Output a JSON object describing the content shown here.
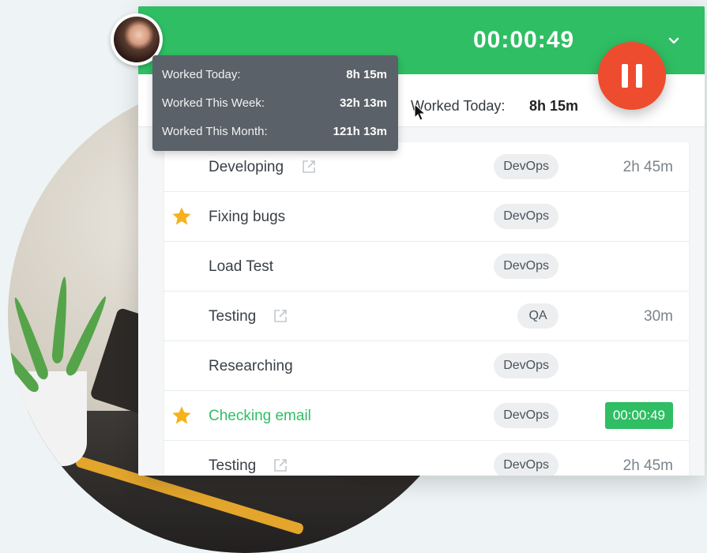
{
  "header": {
    "timer": "00:00:49"
  },
  "subbar": {
    "worked_today_label": "Worked Today:",
    "worked_today_value": "8h 15m"
  },
  "tooltip": {
    "rows": [
      {
        "label": "Worked Today:",
        "value": "8h 15m"
      },
      {
        "label": "Worked This Week:",
        "value": "32h 13m"
      },
      {
        "label": "Worked This Month:",
        "value": "121h 13m"
      }
    ]
  },
  "tasks": [
    {
      "name": "Developing",
      "tag": "DevOps",
      "duration": "2h 45m",
      "starred": false,
      "external": true,
      "active": false
    },
    {
      "name": "Fixing bugs",
      "tag": "DevOps",
      "duration": "",
      "starred": true,
      "external": false,
      "active": false
    },
    {
      "name": "Load Test",
      "tag": "DevOps",
      "duration": "",
      "starred": false,
      "external": false,
      "active": false
    },
    {
      "name": "Testing",
      "tag": "QA",
      "duration": "30m",
      "starred": false,
      "external": true,
      "active": false
    },
    {
      "name": "Researching",
      "tag": "DevOps",
      "duration": "",
      "starred": false,
      "external": false,
      "active": false
    },
    {
      "name": "Checking email",
      "tag": "DevOps",
      "duration": "00:00:49",
      "starred": true,
      "external": false,
      "active": true
    },
    {
      "name": "Testing",
      "tag": "DevOps",
      "duration": "2h 45m",
      "starred": false,
      "external": true,
      "active": false
    }
  ],
  "icons": {
    "star": "star-icon",
    "external": "external-link-icon",
    "pause": "pause-icon",
    "chevron": "chevron-down-icon"
  },
  "colors": {
    "brand_green": "#2fbe64",
    "pause_red": "#ee4c2e",
    "star_yellow": "#f6b21b",
    "tooltip_bg": "#5b6168"
  }
}
